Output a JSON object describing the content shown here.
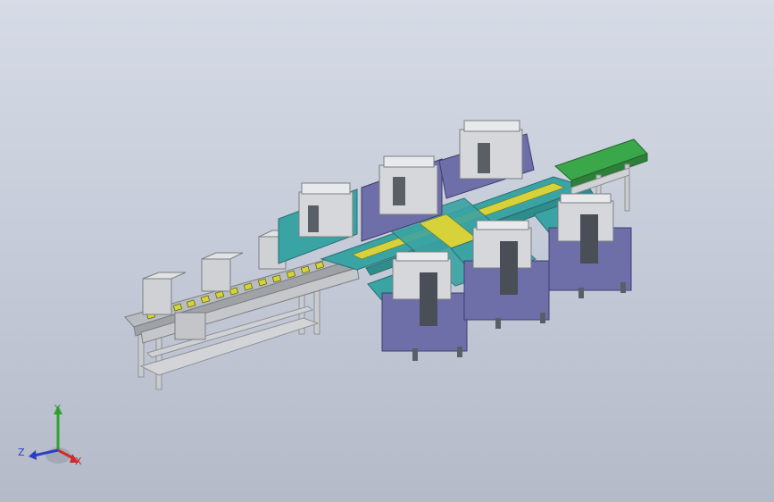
{
  "scene": {
    "description_visible": false,
    "colors": {
      "background_top": "#d6dbe6",
      "background_bottom": "#b4bac8",
      "frame_gray": "#c9cbce",
      "cabinet_navy": "#6e6ea8",
      "conveyor_teal": "#3aa3a3",
      "plate_green": "#3aa84a",
      "part_yellow": "#d8d23a"
    }
  },
  "triad": {
    "x_label": "X",
    "y_label": "Y",
    "z_label": "Z",
    "x_color": "#d02a2a",
    "y_color": "#2fa32f",
    "z_color": "#2a3fbf"
  }
}
